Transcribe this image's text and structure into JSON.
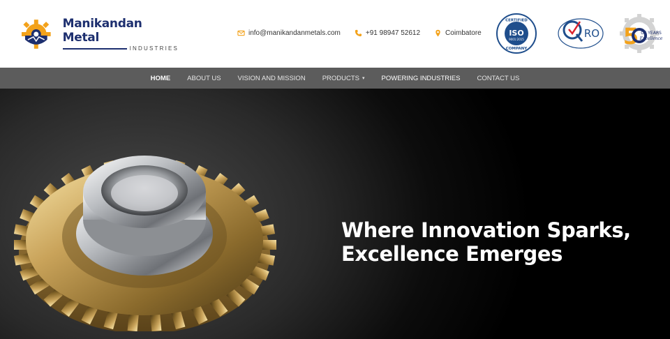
{
  "brand": {
    "name": "Manikandan Metal",
    "subtitle": "INDUSTRIES"
  },
  "contacts": {
    "email": "info@manikandanmetals.com",
    "phone": "+91 98947 52612",
    "location": "Coimbatore",
    "email_icon": "envelope-icon",
    "phone_icon": "phone-icon",
    "location_icon": "map-pin-icon"
  },
  "badges": {
    "iso": {
      "top": "CERTIFIED",
      "center": "ISO",
      "code": "9001:2015",
      "bottom": "COMPANY"
    },
    "qro": {
      "text": "RO"
    },
    "years": {
      "number": "5",
      "label": "OF YEARS",
      "script": "Excellence"
    }
  },
  "nav": {
    "items": [
      {
        "label": "HOME"
      },
      {
        "label": "ABOUT US"
      },
      {
        "label": "VISION AND MISSION"
      },
      {
        "label": "PRODUCTS"
      },
      {
        "label": "POWERING INDUSTRIES"
      },
      {
        "label": "CONTACT US"
      }
    ],
    "products_caret": "▾"
  },
  "hero": {
    "headline_line1": "Where Innovation Sparks,",
    "headline_line2": "Excellence Emerges"
  },
  "colors": {
    "brand_navy": "#1d2f6f",
    "accent_orange": "#f3a21b",
    "nav_bg": "#5c5c5c"
  }
}
